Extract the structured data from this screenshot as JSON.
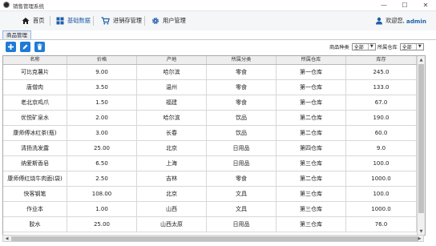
{
  "window": {
    "title": "销售管理系统",
    "controls": {
      "minimize": "—",
      "maximize": "☐",
      "close": "✕"
    }
  },
  "nav": {
    "items": [
      {
        "label": "首页",
        "icon": "home-icon"
      },
      {
        "label": "基础数据",
        "icon": "grid-icon",
        "active": true
      },
      {
        "label": "进销存管理",
        "icon": "cart-icon"
      },
      {
        "label": "用户管理",
        "icon": "gear-icon"
      }
    ],
    "welcome": "欢迎您,",
    "username": "admin",
    "accent": "#1f5fa8"
  },
  "tabs": [
    {
      "label": "商品管理"
    }
  ],
  "toolbar": {
    "buttons": [
      {
        "name": "add",
        "icon": "plus-icon"
      },
      {
        "name": "edit",
        "icon": "pencil-icon"
      },
      {
        "name": "delete",
        "icon": "trash-icon"
      }
    ],
    "button_color": "#1f7bd6",
    "filters": [
      {
        "label": "商品种类",
        "value": "全部"
      },
      {
        "label": "所属仓库",
        "value": "全部"
      }
    ]
  },
  "table": {
    "columns": [
      "名称",
      "价格",
      "产地",
      "所属分类",
      "所属仓库",
      "库存"
    ],
    "rows": [
      [
        "可比克薯片",
        "9.00",
        "哈尔滨",
        "零食",
        "第一仓库",
        "245.0"
      ],
      [
        "唐僧肉",
        "3.50",
        "温州",
        "零食",
        "第一仓库",
        "133.0"
      ],
      [
        "老北京鸡爪",
        "1.50",
        "福建",
        "零食",
        "第一仓库",
        "67.0"
      ],
      [
        "优悦矿泉水",
        "2.00",
        "哈尔滨",
        "饮品",
        "第二仓库",
        "190.0"
      ],
      [
        "康师傅冰红茶(瓶)",
        "3.00",
        "长春",
        "饮品",
        "第二仓库",
        "60.0"
      ],
      [
        "清扬洗发露",
        "25.00",
        "北京",
        "日用品",
        "第四仓库",
        "9.0"
      ],
      [
        "纳爱斯香皂",
        "6.50",
        "上海",
        "日用品",
        "第三仓库",
        "100.0"
      ],
      [
        "康师傅红烧牛肉面(袋)",
        "2.50",
        "吉林",
        "零食",
        "第二仓库",
        "1000.0"
      ],
      [
        "快客钢笔",
        "108.00",
        "北京",
        "文具",
        "第三仓库",
        "100.0"
      ],
      [
        "作业本",
        "1.00",
        "山西",
        "文具",
        "第三仓库",
        "1000.0"
      ],
      [
        "胶水",
        "25.00",
        "山西太原",
        "日用品",
        "第三仓库",
        "76.0"
      ]
    ]
  }
}
